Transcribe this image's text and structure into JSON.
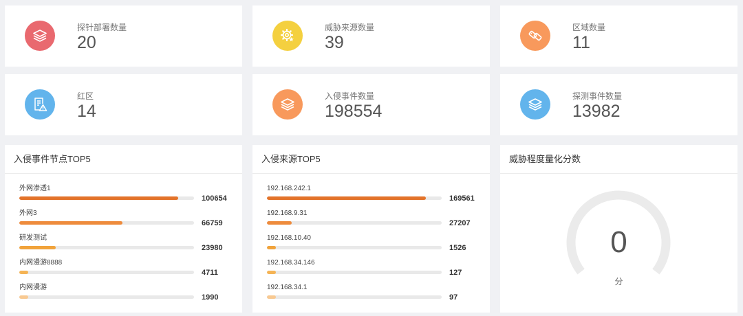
{
  "stats": [
    {
      "label": "探针部署数量",
      "value": "20",
      "icon": "layers-icon",
      "color": "#e9696f"
    },
    {
      "label": "威胁来源数量",
      "value": "39",
      "icon": "gear-icon",
      "color": "#f4d03f"
    },
    {
      "label": "区域数量",
      "value": "11",
      "icon": "tag-icon",
      "color": "#f8995c"
    },
    {
      "label": "红区",
      "value": "14",
      "icon": "document-warning-icon",
      "color": "#62b4ec"
    },
    {
      "label": "入侵事件数量",
      "value": "198554",
      "icon": "layers-icon",
      "color": "#f8995c"
    },
    {
      "label": "探测事件数量",
      "value": "13982",
      "icon": "layers-icon",
      "color": "#62b4ec"
    }
  ],
  "node_top5": {
    "title": "入侵事件节点TOP5",
    "items": [
      {
        "name": "外网渗透1",
        "value": "100654",
        "fill": 0.91,
        "color": "#e3732a"
      },
      {
        "name": "外网3",
        "value": "66759",
        "fill": 0.59,
        "color": "#ee8b3c"
      },
      {
        "name": "研发测试",
        "value": "23980",
        "fill": 0.21,
        "color": "#f1a33b"
      },
      {
        "name": "内网漫游8888",
        "value": "4711",
        "fill": 0.05,
        "color": "#f5b455"
      },
      {
        "name": "内网漫游",
        "value": "1990",
        "fill": 0.05,
        "color": "#f8c992"
      }
    ]
  },
  "source_top5": {
    "title": "入侵来源TOP5",
    "items": [
      {
        "name": "192.168.242.1",
        "value": "169561",
        "fill": 0.91,
        "color": "#e3732a"
      },
      {
        "name": "192.168.9.31",
        "value": "27207",
        "fill": 0.14,
        "color": "#ee8b3c"
      },
      {
        "name": "192.168.10.40",
        "value": "1526",
        "fill": 0.05,
        "color": "#f1a33b"
      },
      {
        "name": "192.168.34.146",
        "value": "127",
        "fill": 0.05,
        "color": "#f5b455"
      },
      {
        "name": "192.168.34.1",
        "value": "97",
        "fill": 0.05,
        "color": "#f8c992"
      }
    ]
  },
  "threat_score": {
    "title": "威胁程度量化分数",
    "value": "0",
    "unit": "分",
    "gauge_level": 0,
    "track_color": "#ebebeb",
    "gauge_color": "#f8995c"
  }
}
